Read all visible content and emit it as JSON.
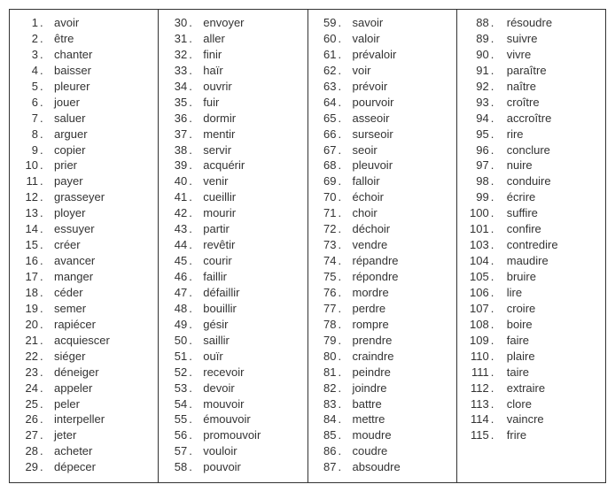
{
  "columns": [
    {
      "items": [
        {
          "n": "1",
          "w": "avoir"
        },
        {
          "n": "2",
          "w": "être"
        },
        {
          "n": "3",
          "w": "chanter"
        },
        {
          "n": "4",
          "w": "baisser"
        },
        {
          "n": "5",
          "w": "pleurer"
        },
        {
          "n": "6",
          "w": "jouer"
        },
        {
          "n": "7",
          "w": "saluer"
        },
        {
          "n": "8",
          "w": "arguer"
        },
        {
          "n": "9",
          "w": "copier"
        },
        {
          "n": "10",
          "w": "prier"
        },
        {
          "n": "11",
          "w": "payer"
        },
        {
          "n": "12",
          "w": "grasseyer"
        },
        {
          "n": "13",
          "w": "ployer"
        },
        {
          "n": "14",
          "w": "essuyer"
        },
        {
          "n": "15",
          "w": "créer"
        },
        {
          "n": "16",
          "w": "avancer"
        },
        {
          "n": "17",
          "w": "manger"
        },
        {
          "n": "18",
          "w": "céder"
        },
        {
          "n": "19",
          "w": "semer"
        },
        {
          "n": "20",
          "w": "rapiécer"
        },
        {
          "n": "21",
          "w": "acquiescer"
        },
        {
          "n": "22",
          "w": "siéger"
        },
        {
          "n": "23",
          "w": "déneiger"
        },
        {
          "n": "24",
          "w": "appeler"
        },
        {
          "n": "25",
          "w": "peler"
        },
        {
          "n": "26",
          "w": "interpeller"
        },
        {
          "n": "27",
          "w": "jeter"
        },
        {
          "n": "28",
          "w": "acheter"
        },
        {
          "n": "29",
          "w": "dépecer"
        }
      ]
    },
    {
      "items": [
        {
          "n": "30",
          "w": "envoyer"
        },
        {
          "n": "31",
          "w": "aller"
        },
        {
          "n": "32",
          "w": "finir"
        },
        {
          "n": "33",
          "w": "haïr"
        },
        {
          "n": "34",
          "w": "ouvrir"
        },
        {
          "n": "35",
          "w": "fuir"
        },
        {
          "n": "36",
          "w": "dormir"
        },
        {
          "n": "37",
          "w": "mentir"
        },
        {
          "n": "38",
          "w": "servir"
        },
        {
          "n": "39",
          "w": "acquérir"
        },
        {
          "n": "40",
          "w": "venir"
        },
        {
          "n": "41",
          "w": "cueillir"
        },
        {
          "n": "42",
          "w": "mourir"
        },
        {
          "n": "43",
          "w": "partir"
        },
        {
          "n": "44",
          "w": "revêtir"
        },
        {
          "n": "45",
          "w": "courir"
        },
        {
          "n": "46",
          "w": "faillir"
        },
        {
          "n": "47",
          "w": "défaillir"
        },
        {
          "n": "48",
          "w": "bouillir"
        },
        {
          "n": "49",
          "w": "gésir"
        },
        {
          "n": "50",
          "w": "saillir"
        },
        {
          "n": "51",
          "w": "ouïr"
        },
        {
          "n": "52",
          "w": "recevoir"
        },
        {
          "n": "53",
          "w": "devoir"
        },
        {
          "n": "54",
          "w": "mouvoir"
        },
        {
          "n": "55",
          "w": "émouvoir"
        },
        {
          "n": "56",
          "w": "promouvoir"
        },
        {
          "n": "57",
          "w": "vouloir"
        },
        {
          "n": "58",
          "w": "pouvoir"
        }
      ]
    },
    {
      "items": [
        {
          "n": "59",
          "w": "savoir"
        },
        {
          "n": "60",
          "w": "valoir"
        },
        {
          "n": "61",
          "w": "prévaloir"
        },
        {
          "n": "62",
          "w": "voir"
        },
        {
          "n": "63",
          "w": "prévoir"
        },
        {
          "n": "64",
          "w": "pourvoir"
        },
        {
          "n": "65",
          "w": "asseoir"
        },
        {
          "n": "66",
          "w": "surseoir"
        },
        {
          "n": "67",
          "w": "seoir"
        },
        {
          "n": "68",
          "w": "pleuvoir"
        },
        {
          "n": "69",
          "w": "falloir"
        },
        {
          "n": "70",
          "w": "échoir"
        },
        {
          "n": "71",
          "w": "choir"
        },
        {
          "n": "72",
          "w": "déchoir"
        },
        {
          "n": "73",
          "w": "vendre"
        },
        {
          "n": "74",
          "w": "répandre"
        },
        {
          "n": "75",
          "w": "répondre"
        },
        {
          "n": "76",
          "w": "mordre"
        },
        {
          "n": "77",
          "w": "perdre"
        },
        {
          "n": "78",
          "w": "rompre"
        },
        {
          "n": "79",
          "w": "prendre"
        },
        {
          "n": "80",
          "w": "craindre"
        },
        {
          "n": "81",
          "w": "peindre"
        },
        {
          "n": "82",
          "w": "joindre"
        },
        {
          "n": "83",
          "w": "battre"
        },
        {
          "n": "84",
          "w": "mettre"
        },
        {
          "n": "85",
          "w": "moudre"
        },
        {
          "n": "86",
          "w": "coudre"
        },
        {
          "n": "87",
          "w": "absoudre"
        }
      ]
    },
    {
      "items": [
        {
          "n": "88",
          "w": "résoudre"
        },
        {
          "n": "89",
          "w": "suivre"
        },
        {
          "n": "90",
          "w": "vivre"
        },
        {
          "n": "91",
          "w": "paraître"
        },
        {
          "n": "92",
          "w": "naître"
        },
        {
          "n": "93",
          "w": "croître"
        },
        {
          "n": "94",
          "w": "accroître"
        },
        {
          "n": "95",
          "w": "rire"
        },
        {
          "n": "96",
          "w": "conclure"
        },
        {
          "n": "97",
          "w": "nuire"
        },
        {
          "n": "98",
          "w": "conduire"
        },
        {
          "n": "99",
          "w": "écrire"
        },
        {
          "n": "100",
          "w": "suffire"
        },
        {
          "n": "101",
          "w": "confire"
        },
        {
          "n": "103",
          "w": "contredire"
        },
        {
          "n": "104",
          "w": "maudire"
        },
        {
          "n": "105",
          "w": "bruire"
        },
        {
          "n": "106",
          "w": "lire"
        },
        {
          "n": "107",
          "w": "croire"
        },
        {
          "n": "108",
          "w": "boire"
        },
        {
          "n": "109",
          "w": "faire"
        },
        {
          "n": "110",
          "w": "plaire"
        },
        {
          "n": "111",
          "w": "taire"
        },
        {
          "n": "112",
          "w": "extraire"
        },
        {
          "n": "113",
          "w": "clore"
        },
        {
          "n": "114",
          "w": "vaincre"
        },
        {
          "n": "115",
          "w": "frire"
        }
      ]
    }
  ]
}
